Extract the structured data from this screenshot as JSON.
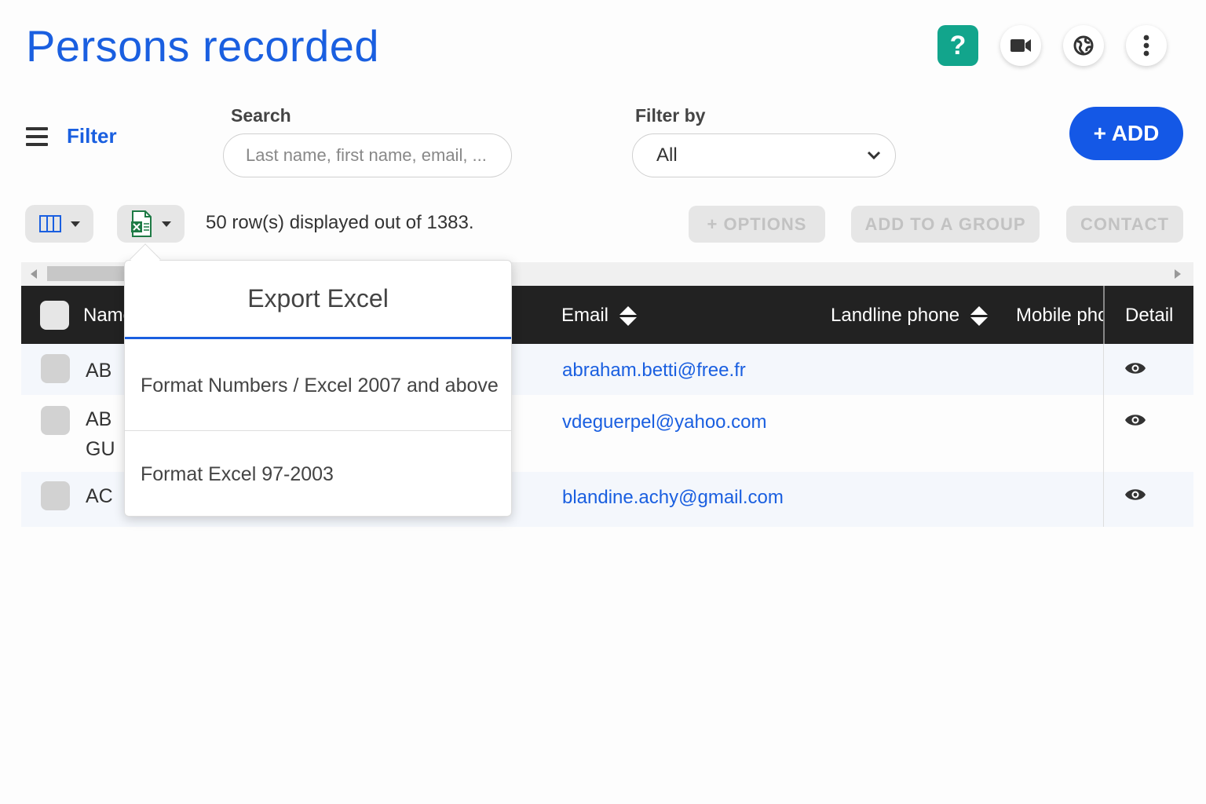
{
  "page": {
    "title": "Persons recorded"
  },
  "top_icons": {
    "help": "?",
    "icons": [
      "question-icon",
      "video-camera-icon",
      "globe-icon",
      "vertical-dots-icon"
    ]
  },
  "filter": {
    "label": "Filter"
  },
  "search": {
    "label": "Search",
    "placeholder": "Last name, first name, email, ..."
  },
  "filter_by": {
    "label": "Filter by",
    "value": "All"
  },
  "add_button": {
    "label": "+ ADD"
  },
  "toolbar": {
    "rows_info": "50 row(s) displayed out of 1383.",
    "options_label": "+ OPTIONS",
    "add_to_group_label": "ADD TO A GROUP",
    "contact_label": "CONTACT"
  },
  "table": {
    "columns": {
      "name": "Name",
      "email": "Email",
      "landline": "Landline phone",
      "mobile": "Mobile phone",
      "detail": "Detail"
    },
    "rows": [
      {
        "name": "AB",
        "email": "abraham.betti@free.fr"
      },
      {
        "name": "AB GU",
        "email": "vdeguerpel@yahoo.com"
      },
      {
        "name": "AC",
        "email": "blandine.achy@gmail.com"
      }
    ]
  },
  "export_menu": {
    "title": "Export Excel",
    "items": [
      "Format Numbers / Excel 2007 and above",
      "Format Excel 97-2003"
    ]
  },
  "colors": {
    "accent": "#1a5fe0",
    "help_button": "#12a58c",
    "add_button": "#1458e6",
    "header_bg": "#222222"
  }
}
